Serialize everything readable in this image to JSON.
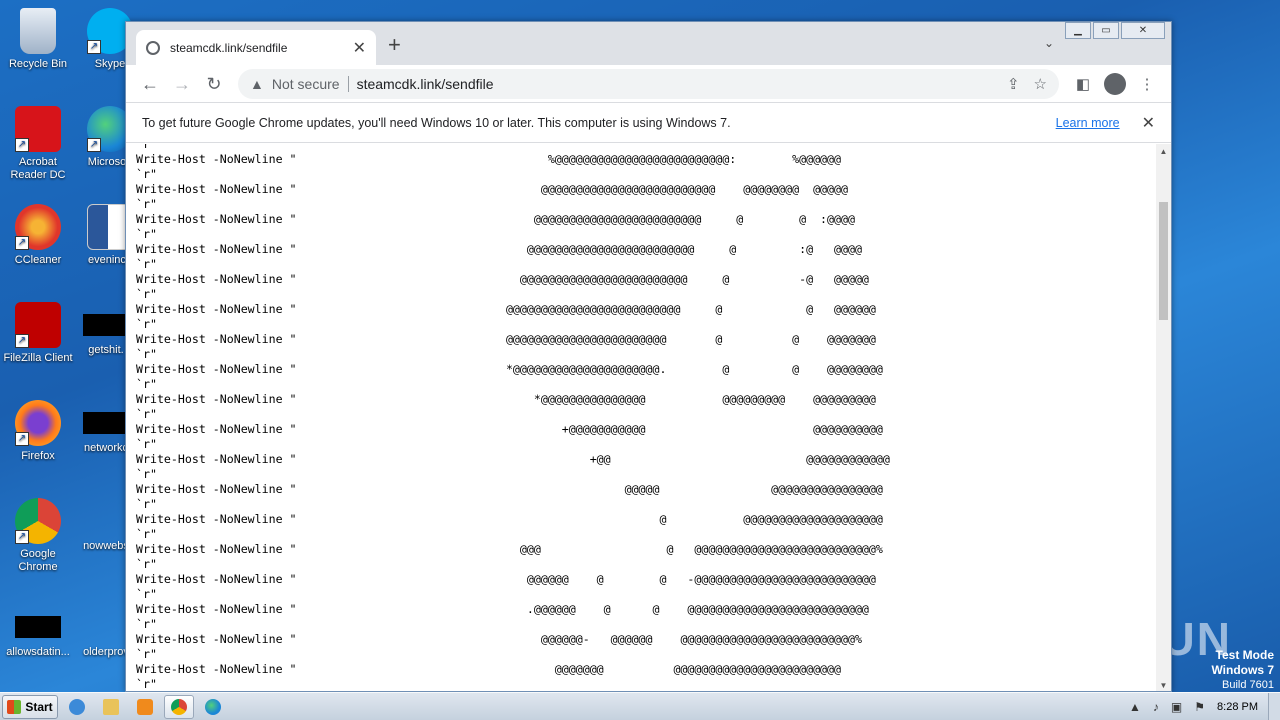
{
  "desktop": {
    "icons": [
      {
        "label": "Recycle Bin"
      },
      {
        "label": "Skype"
      },
      {
        "label": "Acrobat Reader DC"
      },
      {
        "label": "Microsoft"
      },
      {
        "label": "CCleaner"
      },
      {
        "label": "evenince"
      },
      {
        "label": "FileZilla Client"
      },
      {
        "label": "getshit."
      },
      {
        "label": "Firefox"
      },
      {
        "label": "networkc"
      },
      {
        "label": "Google Chrome"
      },
      {
        "label": "nowwebs"
      },
      {
        "label": "allowsdatin..."
      },
      {
        "label": "olderprov"
      }
    ]
  },
  "watermark": {
    "text": "ANY RUN"
  },
  "testmode": {
    "line1": "Test Mode",
    "line2": "Windows 7",
    "line3": "Build 7601"
  },
  "browser": {
    "tab_title": "steamcdk.link/sendfile",
    "new_tab": "+",
    "security_label": "Not secure",
    "url": "steamcdk.link/sendfile",
    "infobar_message": "To get future Google Chrome updates, you'll need Windows 10 or later. This computer is using Windows 7.",
    "infobar_link": "Learn more"
  },
  "page": {
    "lines": [
      "`r\"",
      "Write-Host -NoNewline \"                                    %@@@@@@@@@@@@@@@@@@@@@@@@@:        %@@@@@@",
      "`r\"",
      "Write-Host -NoNewline \"                                   @@@@@@@@@@@@@@@@@@@@@@@@@    @@@@@@@@  @@@@@",
      "`r\"",
      "Write-Host -NoNewline \"                                  @@@@@@@@@@@@@@@@@@@@@@@@     @        @  :@@@@",
      "`r\"",
      "Write-Host -NoNewline \"                                 @@@@@@@@@@@@@@@@@@@@@@@@     @         :@   @@@@",
      "`r\"",
      "Write-Host -NoNewline \"                                @@@@@@@@@@@@@@@@@@@@@@@@     @          -@   @@@@@",
      "`r\"",
      "Write-Host -NoNewline \"                              @@@@@@@@@@@@@@@@@@@@@@@@@     @            @   @@@@@@",
      "`r\"",
      "Write-Host -NoNewline \"                              @@@@@@@@@@@@@@@@@@@@@@@       @          @    @@@@@@@",
      "`r\"",
      "Write-Host -NoNewline \"                              *@@@@@@@@@@@@@@@@@@@@@.        @         @    @@@@@@@@",
      "`r\"",
      "Write-Host -NoNewline \"                                  *@@@@@@@@@@@@@@@           @@@@@@@@@    @@@@@@@@@",
      "`r\"",
      "Write-Host -NoNewline \"                                      +@@@@@@@@@@@                        @@@@@@@@@@",
      "`r\"",
      "Write-Host -NoNewline \"                                          +@@                            @@@@@@@@@@@@",
      "`r\"",
      "Write-Host -NoNewline \"                                               @@@@@                @@@@@@@@@@@@@@@@",
      "`r\"",
      "Write-Host -NoNewline \"                                                    @           @@@@@@@@@@@@@@@@@@@@",
      "`r\"",
      "Write-Host -NoNewline \"                                @@@                  @   @@@@@@@@@@@@@@@@@@@@@@@@@@%",
      "`r\"",
      "Write-Host -NoNewline \"                                 @@@@@@    @        @   -@@@@@@@@@@@@@@@@@@@@@@@@@@",
      "`r\"",
      "Write-Host -NoNewline \"                                 .@@@@@@    @      @    @@@@@@@@@@@@@@@@@@@@@@@@@@",
      "`r\"",
      "Write-Host -NoNewline \"                                   @@@@@@-   @@@@@@    @@@@@@@@@@@@@@@@@@@@@@@@@%",
      "`r\"",
      "Write-Host -NoNewline \"                                     @@@@@@@          @@@@@@@@@@@@@@@@@@@@@@@@",
      "`r\""
    ]
  },
  "taskbar": {
    "start_label": "Start",
    "clock": "8:28 PM"
  }
}
